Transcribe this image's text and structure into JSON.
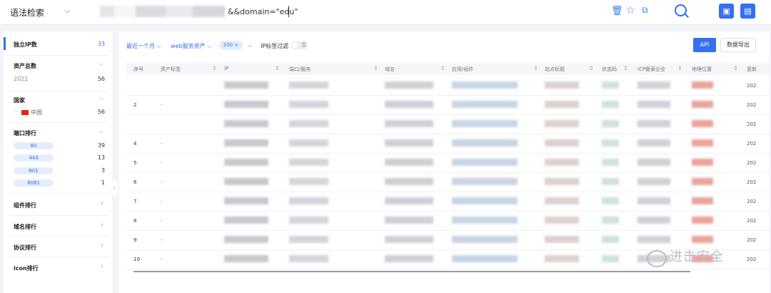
{
  "header": {
    "mode_label": "语法检索",
    "query_visible": "&&domain=\"edu\""
  },
  "sidebar": {
    "unique_ip": {
      "label": "独立IP数",
      "value": "33"
    },
    "asset_total": {
      "label": "资产总数",
      "year": "2022",
      "value": "56"
    },
    "country": {
      "label": "国家",
      "items": [
        {
          "name": "中国",
          "value": "56"
        }
      ]
    },
    "port_rank": {
      "label": "端口排行",
      "items": [
        {
          "port": "80",
          "value": "39"
        },
        {
          "port": "443",
          "value": "13"
        },
        {
          "port": "801",
          "value": "3"
        },
        {
          "port": "8081",
          "value": "1"
        }
      ]
    },
    "sections": [
      "组件排行",
      "域名排行",
      "协议排行",
      "icon排行"
    ]
  },
  "filters": {
    "time": "最近一个月",
    "asset_type": "web服务资产",
    "status_tag": "200",
    "ip_filter_label": "IP标签过滤",
    "toggle_text": "否",
    "api_label": "API",
    "export_label": "数据导出"
  },
  "table": {
    "columns": [
      "序号",
      "资产标签",
      "IP",
      "端口/服务",
      "域名",
      "应用/组件",
      "站点标题",
      "状态码",
      "ICP备案企业",
      "地理位置",
      "更新"
    ],
    "rows": [
      {
        "no": "",
        "tag": "",
        "year": "202"
      },
      {
        "no": "2",
        "tag": "-",
        "year": "202"
      },
      {
        "no": "",
        "tag": "",
        "year": "202"
      },
      {
        "no": "4",
        "tag": "-",
        "year": "202"
      },
      {
        "no": "5",
        "tag": "-",
        "year": "202"
      },
      {
        "no": "6",
        "tag": "-",
        "year": "202"
      },
      {
        "no": "7",
        "tag": "-",
        "year": "202"
      },
      {
        "no": "8",
        "tag": "-",
        "year": "202"
      },
      {
        "no": "9",
        "tag": "-",
        "year": "202"
      },
      {
        "no": "10",
        "tag": "-",
        "year": "202"
      }
    ]
  },
  "watermark": {
    "text": "进击安全"
  }
}
